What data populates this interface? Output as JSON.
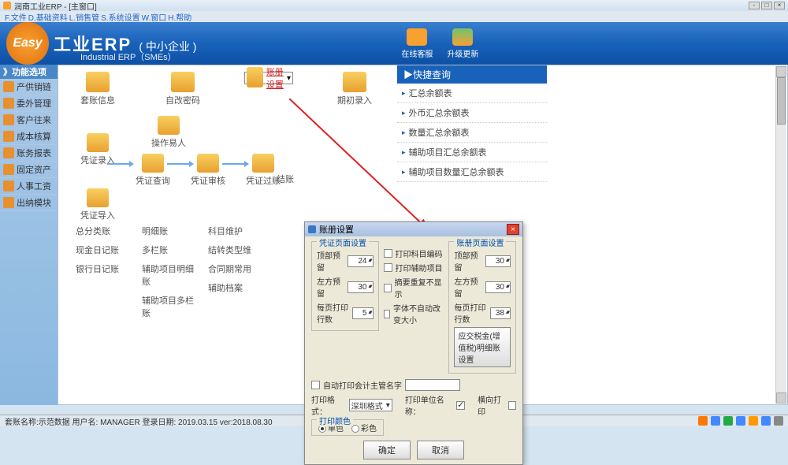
{
  "window_title": "润南工业ERP - [主窗口]",
  "menubar": [
    "F.文件",
    "D.基础资料",
    "L.销售管",
    "S.系统设置",
    "W.窗口",
    "H.帮助"
  ],
  "banner": {
    "logo_text": "Easy",
    "title_main": "工业ERP",
    "title_sub": "( 中小企业 )",
    "subtitle": "Industrial ERP（SMEs）",
    "btn1": "在线客服",
    "btn2": "升级更新"
  },
  "sidebar": {
    "header": "》功能选项",
    "items": [
      "产供销链",
      "委外管理",
      "客户往来",
      "成本核算",
      "账务报表",
      "固定资产",
      "人事工资",
      "出纳模块"
    ]
  },
  "flow_top": [
    {
      "label": "套账信息"
    },
    {
      "label": "自改密码"
    },
    {
      "label": "账册设置",
      "selected": true
    },
    {
      "label": "期初录入"
    }
  ],
  "flow_nodes": {
    "n1": "凭证录入",
    "n2": "操作易人",
    "n3": "凭证查询",
    "n4": "凭证审核",
    "n5": "凭证过账",
    "n6": "凭证导入",
    "n7": "结账"
  },
  "quick": {
    "header": "▶快捷查询",
    "items": [
      "汇总余额表",
      "外币汇总余额表",
      "数量汇总余额表",
      "辅助项目汇总余额表",
      "辅助项目数量汇总余额表"
    ]
  },
  "bottom": {
    "c1": [
      "总分类账",
      "现金日记账",
      "银行日记账"
    ],
    "c2": [
      "明细账",
      "多栏账",
      "辅助项目明细账",
      "辅助项目多栏账"
    ],
    "c3": [
      "科目维护",
      "结转类型维",
      "合同期常用",
      "辅助档案"
    ]
  },
  "dialog": {
    "title": "账册设置",
    "group1_title": "凭证页面设置",
    "group2_title": "账册页面设置",
    "lbl_top_margin": "顶部预留",
    "lbl_left_margin": "左方预留",
    "lbl_rows": "每页打印行数",
    "val_top1": "24",
    "val_left1": "30",
    "val_rows1": "5",
    "chk1": "打印科目编码",
    "chk2": "打印辅助项目",
    "chk3": "摘要重复不显示",
    "chk4": "字体不自动改变大小",
    "chk_auto": "自动打印会计主管名字",
    "val_top2": "30",
    "val_left2": "30",
    "val_rows2": "38",
    "btn_tax": "应交税金(增值税)明细账设置",
    "lbl_format": "打印格式：",
    "sel_format": "深圳格式",
    "lbl_unit": "打印单位名称：",
    "lbl_horiz": "横向打印",
    "lbl_color": "打印颜色",
    "radio_mono": "单色",
    "radio_color": "彩色",
    "btn_ok": "确定",
    "btn_cancel": "取消"
  },
  "statusbar": "套账名称:示范数据  用户名: MANAGER   登录日期: 2019.03.15  ver:2018.08.30",
  "chart_data": null
}
